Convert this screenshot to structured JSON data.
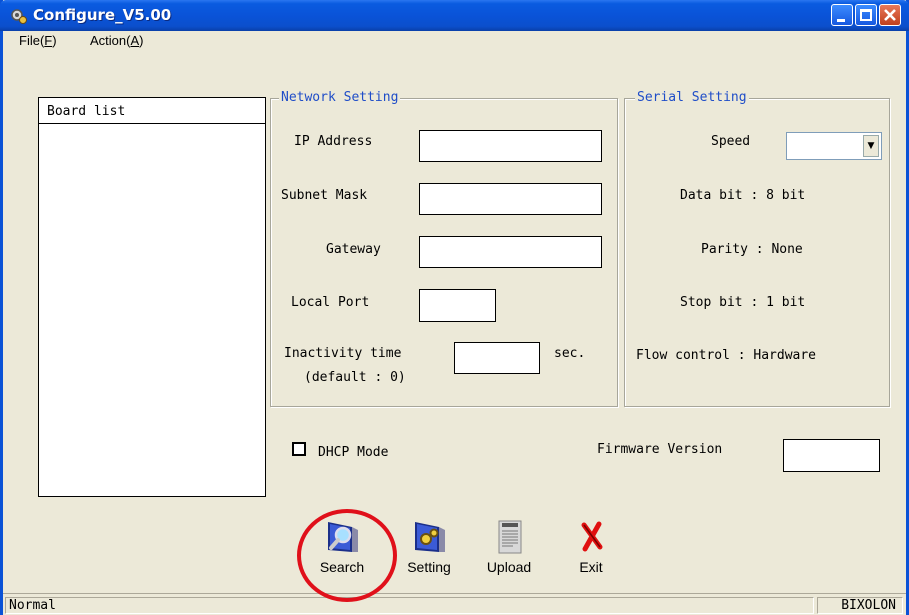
{
  "window": {
    "title": "Configure_V5.00"
  },
  "menu": {
    "file": "File(F)",
    "action": "Action(A)"
  },
  "board_list": {
    "header": "Board list"
  },
  "network": {
    "group_title": "Network Setting",
    "ip_label": "IP Address",
    "ip_value": "",
    "subnet_label": "Subnet Mask",
    "subnet_value": "",
    "gateway_label": "Gateway",
    "gateway_value": "",
    "port_label": "Local Port",
    "port_value": "",
    "inactivity_label": "Inactivity time",
    "inactivity_default": "(default : 0)",
    "inactivity_value": "",
    "inactivity_unit": "sec."
  },
  "serial": {
    "group_title": "Serial Setting",
    "speed_label": "Speed",
    "speed_value": "",
    "data_bit": "Data bit : 8 bit",
    "parity": "Parity : None",
    "stop_bit": "Stop bit : 1 bit",
    "flow_control": "Flow control : Hardware"
  },
  "dhcp": {
    "label": "DHCP Mode",
    "checked": false
  },
  "firmware": {
    "label": "Firmware Version",
    "value": ""
  },
  "toolbar": {
    "search": "Search",
    "setting": "Setting",
    "upload": "Upload",
    "exit": "Exit"
  },
  "status": {
    "left": "Normal",
    "right": "BIXOLON"
  },
  "colors": {
    "title_bar": "#0a53d8",
    "group_title": "#1f4dc8",
    "highlight_circle": "#e0101a"
  },
  "icons": [
    "gear-icon",
    "minimize-icon",
    "maximize-icon",
    "close-icon",
    "search-icon",
    "setting-icon",
    "upload-icon",
    "exit-icon",
    "dropdown-arrow-icon"
  ]
}
